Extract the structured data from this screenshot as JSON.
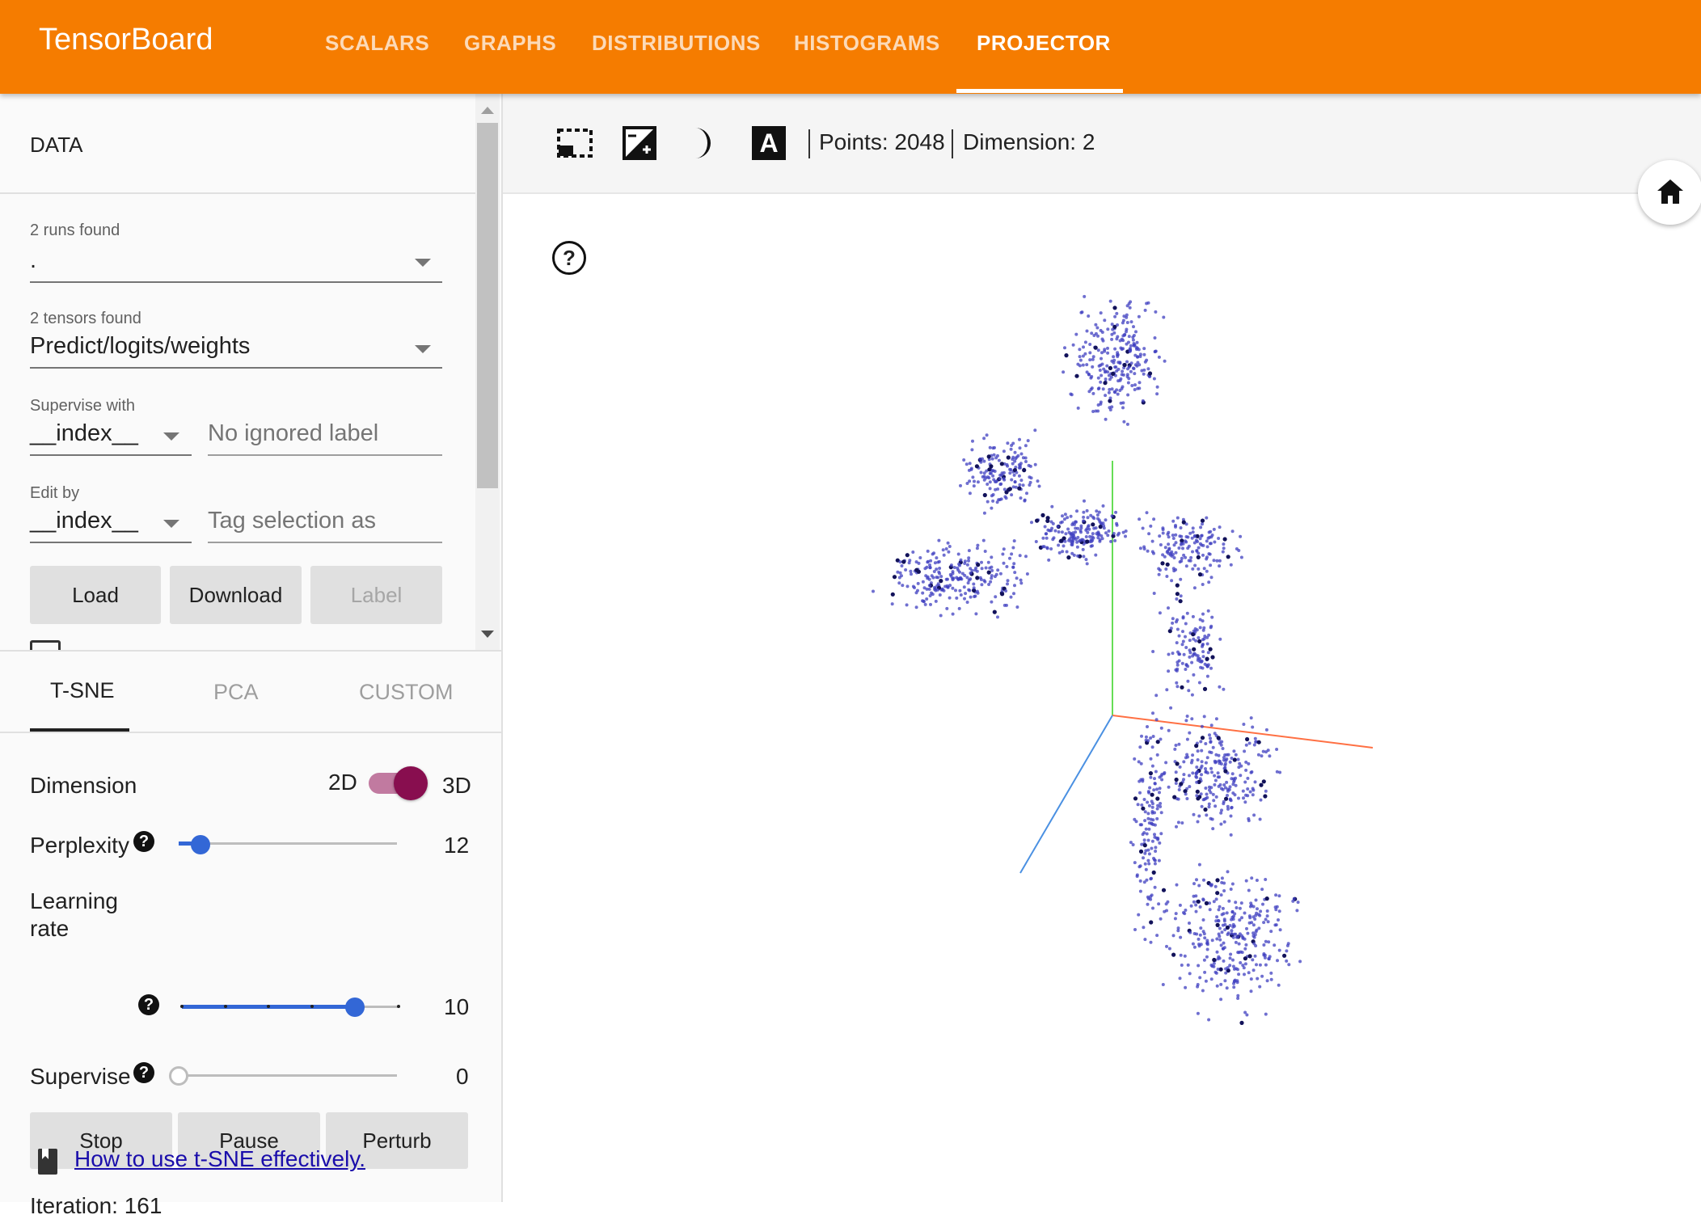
{
  "app": {
    "brand": "TensorBoard",
    "nav": [
      "SCALARS",
      "GRAPHS",
      "DISTRIBUTIONS",
      "HISTOGRAMS",
      "PROJECTOR"
    ],
    "active_nav": "PROJECTOR",
    "accent_color": "#f57c00"
  },
  "data_panel": {
    "title": "DATA",
    "runs_label": "2 runs found",
    "runs_value": ".",
    "tensors_label": "2 tensors found",
    "tensors_value": "Predict/logits/weights",
    "supervise_label": "Supervise with",
    "supervise_value": "__index__",
    "ignored_placeholder": "No ignored label",
    "edit_label": "Edit by",
    "edit_value": "__index__",
    "tag_placeholder": "Tag selection as",
    "buttons": {
      "load": "Load",
      "download": "Download",
      "label": "Label"
    }
  },
  "method_tabs": {
    "tsne": "T-SNE",
    "pca": "PCA",
    "custom": "CUSTOM",
    "active": "T-SNE"
  },
  "tsne": {
    "dimension_label": "Dimension",
    "dim_2d": "2D",
    "dim_3d": "3D",
    "dimension_3d_on": true,
    "perplexity_label": "Perplexity",
    "perplexity_value": "12",
    "perplexity_fraction": 0.1,
    "learning_rate_label": "Learning rate",
    "learning_rate_value": "10",
    "learning_rate_fraction": 0.8,
    "supervise_label": "Supervise",
    "supervise_value": "0",
    "supervise_fraction": 0.0,
    "buttons": {
      "stop": "Stop",
      "pause": "Pause",
      "perturb": "Perturb"
    },
    "iteration_text": "Iteration: 161",
    "help_link": "How to use t-SNE effectively."
  },
  "toolbar": {
    "icons": [
      "select-region-icon",
      "night-mode-icon",
      "moon-icon",
      "labels-icon"
    ],
    "points_text": "Points: 2048",
    "dimension_text": "Dimension: 2"
  },
  "viz": {
    "help_icon": "help-circle-icon",
    "home_icon": "home-icon",
    "point_color": "#3f3fc0",
    "axis_colors": {
      "x": "#ff7043",
      "y": "#66dd55",
      "z": "#4a90e2"
    }
  }
}
